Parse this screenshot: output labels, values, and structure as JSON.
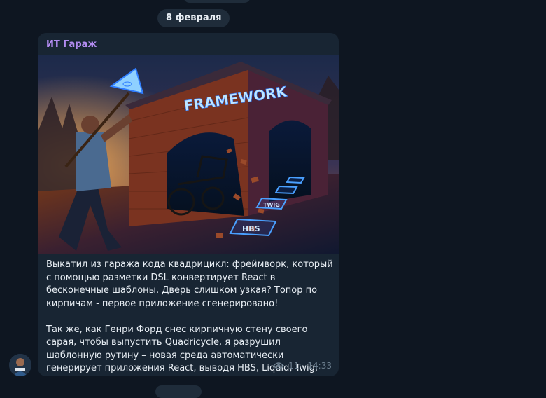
{
  "date_separator": "8 февраля",
  "post": {
    "channel": "ИТ Гараж",
    "image_caption": {
      "framework_sign": "FRAMEWORK",
      "tiles": [
        "HBS",
        "TWIG",
        "",
        ""
      ]
    },
    "paragraphs": [
      "Выкатил из гаража кода квадрицикл: фреймворк, который с помощью разметки DSL конвертирует React в бесконечные шаблоны. Дверь слишком узкая? Топор по кирпичам - первое приложение сгенерировано!",
      "Так же, как Генри Форд снес кирпичную стену своего сарая, чтобы выпустить Quadricycle, я разрушил шаблонную рутину – новая среда автоматически генерирует приложения React, выводя HBS, Liquid, Twig, Latte через DSL"
    ],
    "views": "11",
    "time": "14:33",
    "icons": {
      "views": "eye-icon"
    }
  },
  "colors": {
    "background": "#0e1621",
    "bubble": "#182533",
    "channel_name": "#b28bf0",
    "meta": "#6d7f8f",
    "neon": "#2f7dff"
  }
}
